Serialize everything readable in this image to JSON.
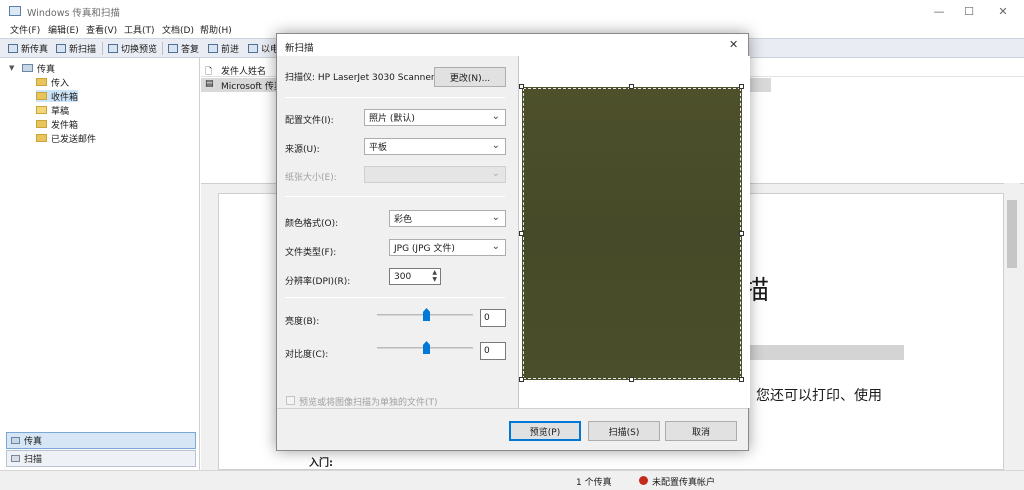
{
  "window": {
    "title": "Windows 传真和扫描",
    "controls": {
      "minimize": "—",
      "maximize": "☐",
      "close": "✕"
    }
  },
  "menu": [
    "文件(F)",
    "编辑(E)",
    "查看(V)",
    "工具(T)",
    "文档(D)",
    "帮助(H)"
  ],
  "toolbar": [
    "新传真",
    "新扫描",
    "切换预览",
    "答复",
    "前进",
    "以电"
  ],
  "tree": {
    "root": "传真",
    "items": [
      "传入",
      "收件箱",
      "草稿",
      "发件箱",
      "已发送邮件"
    ],
    "selected": "收件箱"
  },
  "nav": {
    "fax": "传真",
    "scan": "扫描"
  },
  "list": {
    "header": "发件人姓名",
    "row": "Microsoft 传真"
  },
  "document": {
    "heading_fragment": "描",
    "body_fragment": "您还可以打印、使用",
    "subheading": "入门:"
  },
  "status": {
    "count": "1 个传真",
    "account": "未配置传真帐户"
  },
  "dialog": {
    "title": "新扫描",
    "close": "✕",
    "scanner_label": "扫描仪: HP LaserJet 3030 Scanner",
    "change_button": "更改(N)...",
    "profile_label": "配置文件(I):",
    "profile_value": "照片 (默认)",
    "source_label": "来源(U):",
    "source_value": "平板",
    "paper_label": "纸张大小(E):",
    "color_label": "颜色格式(O):",
    "color_value": "彩色",
    "filetype_label": "文件类型(F):",
    "filetype_value": "JPG (JPG 文件)",
    "dpi_label": "分辨率(DPI)(R):",
    "dpi_value": "300",
    "brightness_label": "亮度(B):",
    "brightness_value": "0",
    "contrast_label": "对比度(C):",
    "contrast_value": "0",
    "separate_files_label": "预览或将图像扫描为单独的文件(T)",
    "preview_button": "预览(P)",
    "scan_button": "扫描(S)",
    "cancel_button": "取消",
    "preview_image_color": "#4a4d2a"
  }
}
